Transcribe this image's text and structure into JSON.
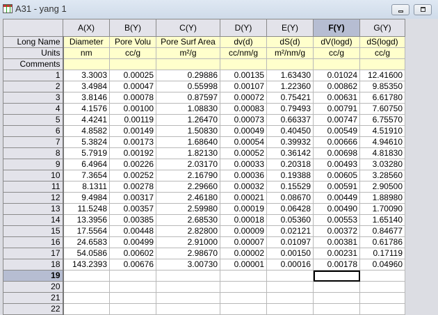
{
  "window": {
    "title": "A31 - yang 1"
  },
  "columns": [
    {
      "name": "A(X)",
      "long_name": "Diameter",
      "units": "nm"
    },
    {
      "name": "B(Y)",
      "long_name": "Pore Volu",
      "units": "cc/g"
    },
    {
      "name": "C(Y)",
      "long_name": "Pore Surf Area",
      "units": "m²/g"
    },
    {
      "name": "D(Y)",
      "long_name": "dv(d)",
      "units": "cc/nm/g"
    },
    {
      "name": "E(Y)",
      "long_name": "dS(d)",
      "units": "m²/nm/g"
    },
    {
      "name": "F(Y)",
      "long_name": "dV(logd)",
      "units": "cc/g"
    },
    {
      "name": "G(Y)",
      "long_name": "dS(logd)",
      "units": "cc/g"
    }
  ],
  "row_labels": {
    "long_name": "Long Name",
    "units": "Units",
    "comments": "Comments"
  },
  "rows": [
    [
      "1",
      [
        "3.3003",
        "0.00025",
        "0.29886",
        "0.00135",
        "1.63430",
        "0.01024",
        "12.41600"
      ]
    ],
    [
      "2",
      [
        "3.4984",
        "0.00047",
        "0.55998",
        "0.00107",
        "1.22360",
        "0.00862",
        "9.85350"
      ]
    ],
    [
      "3",
      [
        "3.8146",
        "0.00078",
        "0.87597",
        "0.00072",
        "0.75421",
        "0.00631",
        "6.61780"
      ]
    ],
    [
      "4",
      [
        "4.1576",
        "0.00100",
        "1.08830",
        "0.00083",
        "0.79493",
        "0.00791",
        "7.60750"
      ]
    ],
    [
      "5",
      [
        "4.4241",
        "0.00119",
        "1.26470",
        "0.00073",
        "0.66337",
        "0.00747",
        "6.75570"
      ]
    ],
    [
      "6",
      [
        "4.8582",
        "0.00149",
        "1.50830",
        "0.00049",
        "0.40450",
        "0.00549",
        "4.51910"
      ]
    ],
    [
      "7",
      [
        "5.3824",
        "0.00173",
        "1.68640",
        "0.00054",
        "0.39932",
        "0.00666",
        "4.94610"
      ]
    ],
    [
      "8",
      [
        "5.7919",
        "0.00192",
        "1.82130",
        "0.00052",
        "0.36142",
        "0.00698",
        "4.81830"
      ]
    ],
    [
      "9",
      [
        "6.4964",
        "0.00226",
        "2.03170",
        "0.00033",
        "0.20318",
        "0.00493",
        "3.03280"
      ]
    ],
    [
      "10",
      [
        "7.3654",
        "0.00252",
        "2.16790",
        "0.00036",
        "0.19388",
        "0.00605",
        "3.28560"
      ]
    ],
    [
      "11",
      [
        "8.1311",
        "0.00278",
        "2.29660",
        "0.00032",
        "0.15529",
        "0.00591",
        "2.90500"
      ]
    ],
    [
      "12",
      [
        "9.4984",
        "0.00317",
        "2.46180",
        "0.00021",
        "0.08670",
        "0.00449",
        "1.88980"
      ]
    ],
    [
      "13",
      [
        "11.5248",
        "0.00357",
        "2.59980",
        "0.00019",
        "0.06428",
        "0.00490",
        "1.70090"
      ]
    ],
    [
      "14",
      [
        "13.3956",
        "0.00385",
        "2.68530",
        "0.00018",
        "0.05360",
        "0.00553",
        "1.65140"
      ]
    ],
    [
      "15",
      [
        "17.5564",
        "0.00448",
        "2.82800",
        "0.00009",
        "0.02121",
        "0.00372",
        "0.84677"
      ]
    ],
    [
      "16",
      [
        "24.6583",
        "0.00499",
        "2.91000",
        "0.00007",
        "0.01097",
        "0.00381",
        "0.61786"
      ]
    ],
    [
      "17",
      [
        "54.0586",
        "0.00602",
        "2.98670",
        "0.00002",
        "0.00150",
        "0.00231",
        "0.17119"
      ]
    ],
    [
      "18",
      [
        "143.2393",
        "0.00676",
        "3.00730",
        "0.00001",
        "0.00016",
        "0.00178",
        "0.04960"
      ]
    ],
    [
      "19",
      [
        "",
        "",
        "",
        "",
        "",
        "",
        ""
      ]
    ],
    [
      "20",
      [
        "",
        "",
        "",
        "",
        "",
        "",
        ""
      ]
    ],
    [
      "21",
      [
        "",
        "",
        "",
        "",
        "",
        "",
        ""
      ]
    ],
    [
      "22",
      [
        "",
        "",
        "",
        "",
        "",
        "",
        ""
      ]
    ]
  ],
  "selection": {
    "column": "F(Y)",
    "row": "19"
  }
}
